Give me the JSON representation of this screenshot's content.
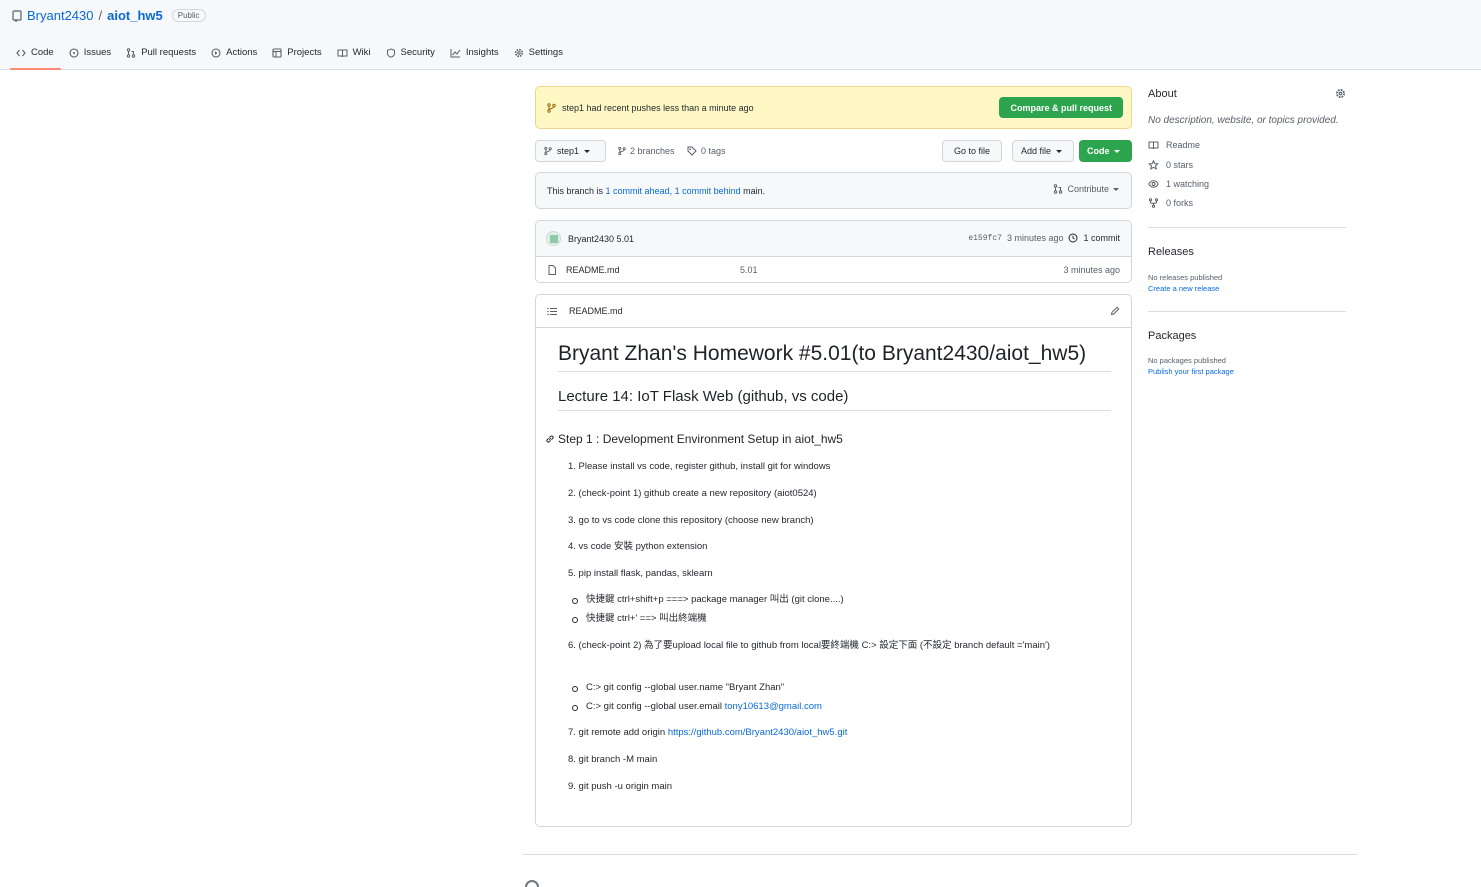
{
  "repo": {
    "owner": "Bryant2430",
    "separator": "/",
    "name": "aiot_hw5",
    "visibility": "Public"
  },
  "tabs": [
    {
      "label": "Code",
      "icon": "code-icon",
      "active": true
    },
    {
      "label": "Issues",
      "icon": "issue-icon"
    },
    {
      "label": "Pull requests",
      "icon": "pull-request-icon"
    },
    {
      "label": "Actions",
      "icon": "play-icon"
    },
    {
      "label": "Projects",
      "icon": "table-icon"
    },
    {
      "label": "Wiki",
      "icon": "book-icon"
    },
    {
      "label": "Security",
      "icon": "shield-icon"
    },
    {
      "label": "Insights",
      "icon": "graph-icon"
    },
    {
      "label": "Settings",
      "icon": "gear-icon"
    }
  ],
  "flash": {
    "text": "step1 had recent pushes less than a minute ago",
    "button": "Compare & pull request"
  },
  "toolbar": {
    "branch": "step1",
    "branches": "2 branches",
    "tags": "0 tags",
    "go_to_file": "Go to file",
    "add_file": "Add file",
    "code": "Code"
  },
  "branch_info": {
    "prefix": "This branch is",
    "ahead": "1 commit ahead,",
    "behind": "1 commit behind",
    "suffix": "main.",
    "contribute": "Contribute"
  },
  "latest_commit": {
    "author_message": "Bryant2430 5.01",
    "sha": "e159fc7",
    "age": "3 minutes ago",
    "count": "1 commit"
  },
  "files": [
    {
      "name": "README.md",
      "message": "5.01",
      "age": "3 minutes ago"
    }
  ],
  "readme": {
    "filename": "README.md",
    "h1": "Bryant Zhan's Homework #5.01(to Bryant2430/aiot_hw5)",
    "h2": "Lecture 14: IoT Flask Web (github, vs code)",
    "h3": "Step 1 : Development Environment Setup in aiot_hw5",
    "items": {
      "i1": "1. Please install vs code, register github, install git for windows",
      "i2": "2. (check-point 1) github create a new repository (aiot0524)",
      "i3": "3. go to vs code clone this repository (choose new branch)",
      "i4": "4. vs code 安裝 python extension",
      "i5": "5. pip install flask, pandas, sklearn",
      "i5a": "快捷鍵 ctrl+shift+p ===> package manager 叫出 (git clone....)",
      "i5b": "快捷鍵 ctrl+' ==> 叫出終端機",
      "i6": "6. (check-point 2) 為了要upload local file to github from local要終端機 C:> 設定下面 (不設定 branch default ='main')",
      "i6a": "C:> git config --global user.name \"Bryant Zhan\"",
      "i6b_prefix": "C:> git config --global user.email",
      "i6b_email": "tony10613@gmail.com",
      "i7_prefix": "7. git remote add origin",
      "i7_url": "https://github.com/Bryant2430/aiot_hw5.git",
      "i8": "8. git branch -M main",
      "i9": "9. git push -u origin main"
    }
  },
  "sidebar": {
    "about_title": "About",
    "description": "No description, website, or topics provided.",
    "readme": "Readme",
    "stars": "0 stars",
    "watching": "1 watching",
    "forks": "0 forks",
    "releases_title": "Releases",
    "releases_none": "No releases published",
    "releases_create": "Create a new release",
    "packages_title": "Packages",
    "packages_none": "No packages published",
    "packages_publish": "Publish your first package"
  },
  "colors": {
    "accent": "#0969da",
    "primary_button": "#2da44e",
    "active_tab_underline": "#fd8c73",
    "flash_background": "#fff8c5"
  }
}
